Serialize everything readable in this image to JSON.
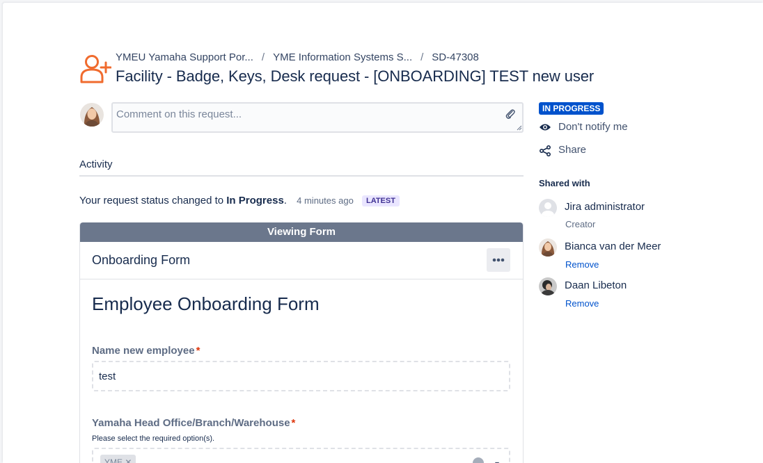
{
  "breadcrumbs": {
    "items": [
      "YMEU Yamaha Support Por...",
      "YME Information Systems S...",
      "SD-47308"
    ],
    "separator": "/"
  },
  "request": {
    "title": "Facility - Badge, Keys, Desk request - [ONBOARDING] TEST new user",
    "icon": "person-add-icon",
    "icon_color": "#f06b2e"
  },
  "comment": {
    "placeholder": "Comment on this request...",
    "attach_icon": "paperclip-icon"
  },
  "activity": {
    "heading": "Activity",
    "status_prefix": "Your request status changed to",
    "status_value": "In Progress",
    "status_suffix": ".",
    "time": "4 minutes ago",
    "badge": "LATEST"
  },
  "form": {
    "view_bar": "Viewing Form",
    "name": "Onboarding Form",
    "more_icon": "ellipsis-icon",
    "heading": "Employee Onboarding Form",
    "fields": [
      {
        "label": "Name new employee",
        "required_mark": "*",
        "value": "test"
      },
      {
        "label": "Yamaha Head Office/Branch/Warehouse",
        "required_mark": "*",
        "help": "Please select the required option(s).",
        "selected": "YME"
      }
    ]
  },
  "sidebar": {
    "status": "IN PROGRESS",
    "status_color": "#0052cc",
    "notify": {
      "label": "Don't notify me",
      "icon": "eye-icon"
    },
    "share": {
      "label": "Share",
      "icon": "share-icon"
    },
    "shared_with_title": "Shared with",
    "people": [
      {
        "name": "Jira administrator",
        "sub": "Creator"
      },
      {
        "name": "Bianca van der Meer",
        "action": "Remove"
      },
      {
        "name": "Daan Libeton",
        "action": "Remove"
      }
    ]
  }
}
